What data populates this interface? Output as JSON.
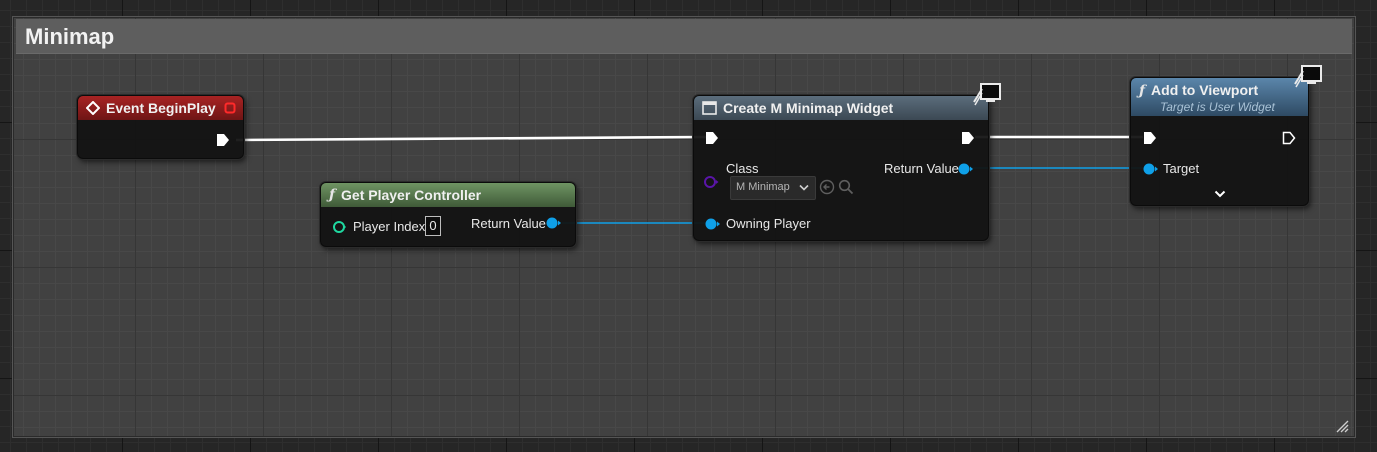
{
  "comment": {
    "title": "Minimap"
  },
  "nodes": {
    "event_begin_play": {
      "title": "Event BeginPlay",
      "icon": "event-diamond-icon",
      "header_color": "#8b1c1c"
    },
    "get_player_controller": {
      "title": "Get Player Controller",
      "icon": "function-icon",
      "header_color": "#58794f",
      "player_index_label": "Player Index",
      "player_index_value": "0",
      "return_label": "Return Value"
    },
    "create_widget": {
      "title": "Create M Minimap Widget",
      "icon": "widget-icon",
      "header_color": "#4d5d6b",
      "class_label": "Class",
      "class_value": "M Minimap",
      "return_label": "Return Value",
      "owning_label": "Owning Player"
    },
    "add_to_viewport": {
      "title": "Add to Viewport",
      "subtitle": "Target is User Widget",
      "icon": "function-icon",
      "header_color": "#4a6e8c",
      "target_label": "Target"
    }
  },
  "colors": {
    "exec_wire": "#ffffff",
    "object_pin": "#0fa0e8",
    "class_pin": "#5a15a8",
    "int_pin": "#1fd8a0"
  }
}
